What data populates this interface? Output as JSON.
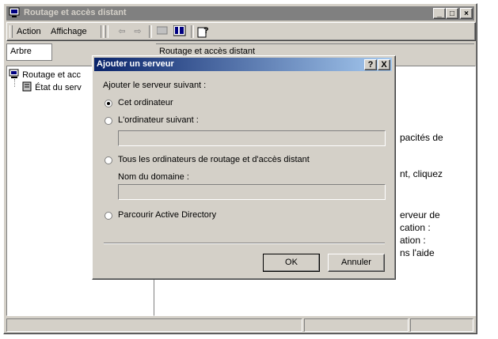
{
  "window": {
    "title": "Routage et accès distant"
  },
  "menu": {
    "action": "Action",
    "affichage": "Affichage"
  },
  "tabs": {
    "arbre": "Arbre"
  },
  "tree": {
    "root": "Routage et acc",
    "child": "État du serv"
  },
  "content_header": "Routage et accès distant",
  "content_lines": [
    "pacités de",
    "nt, cliquez",
    "erveur de",
    "cation :",
    "ation :",
    "ns l'aide"
  ],
  "dialog": {
    "title": "Ajouter un serveur",
    "help_btn": "?",
    "close_btn": "X",
    "intro": "Ajouter le serveur suivant :",
    "opt_this": "Cet ordinateur",
    "opt_following": "L'ordinateur suivant :",
    "opt_all": "Tous les ordinateurs de routage et d'accès distant",
    "domain_label": "Nom du domaine :",
    "opt_ad": "Parcourir Active Directory",
    "ok": "OK",
    "cancel": "Annuler",
    "selected_option": "this_computer"
  },
  "colors": {
    "dialog_title_start": "#0a246a",
    "dialog_title_end": "#a6caf0",
    "face": "#d4d0c8"
  }
}
